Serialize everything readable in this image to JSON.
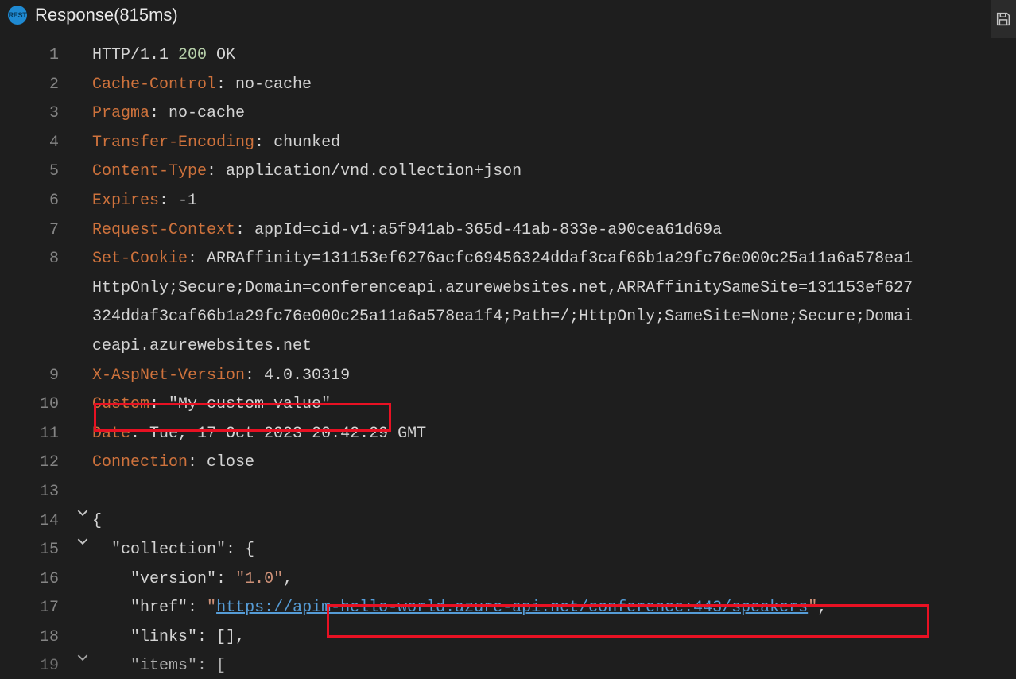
{
  "header": {
    "title": "Response(815ms)"
  },
  "lines": {
    "l1": {
      "proto": "HTTP/1.1 ",
      "code": "200",
      "status": " OK"
    },
    "l2": {
      "name": "Cache-Control",
      "sep": ": ",
      "val": "no-cache"
    },
    "l3": {
      "name": "Pragma",
      "sep": ": ",
      "val": "no-cache"
    },
    "l4": {
      "name": "Transfer-Encoding",
      "sep": ": ",
      "val": "chunked"
    },
    "l5": {
      "name": "Content-Type",
      "sep": ": ",
      "val": "application/vnd.collection+json"
    },
    "l6": {
      "name": "Expires",
      "sep": ": ",
      "val": "-1"
    },
    "l7": {
      "name": "Request-Context",
      "sep": ": ",
      "val": "appId=cid-v1:a5f941ab-365d-41ab-833e-a90cea61d69a"
    },
    "l8": {
      "name": "Set-Cookie",
      "sep": ": ",
      "val1": "ARRAffinity=131153ef6276acfc69456324ddaf3caf66b1a29fc76e000c25a11a6a578ea1",
      "val2": "HttpOnly;Secure;Domain=conferenceapi.azurewebsites.net,ARRAffinitySameSite=131153ef627",
      "val3": "324ddaf3caf66b1a29fc76e000c25a11a6a578ea1f4;Path=/;HttpOnly;SameSite=None;Secure;Domai",
      "val4": "ceapi.azurewebsites.net"
    },
    "l9": {
      "name": "X-AspNet-Version",
      "sep": ": ",
      "val": "4.0.30319"
    },
    "l10": {
      "name": "Custom",
      "sep": ": ",
      "val": "\"My custom value\""
    },
    "l11": {
      "name": "Date",
      "sep": ": ",
      "val": "Tue, 17 Oct 2023 20:42:29 GMT"
    },
    "l12": {
      "name": "Connection",
      "sep": ": ",
      "val": "close"
    },
    "l13": {
      "text": ""
    },
    "l14": {
      "text": "{"
    },
    "l15": {
      "indent": "  ",
      "key": "\"collection\"",
      "after": ": {"
    },
    "l16": {
      "indent": "    ",
      "key": "\"version\"",
      "sep": ": ",
      "val": "\"1.0\"",
      "after": ","
    },
    "l17": {
      "indent": "    ",
      "key": "\"href\"",
      "sep": ": ",
      "q1": "\"",
      "url": "https://apim-hello-world.azure-api.net/conference:443/speakers",
      "q2": "\"",
      "after": ","
    },
    "l18": {
      "indent": "    ",
      "key": "\"links\"",
      "after": ": [],"
    },
    "l19": {
      "indent": "    ",
      "key": "\"items\"",
      "after": ": ["
    }
  },
  "gutter": {
    "n1": "1",
    "n2": "2",
    "n3": "3",
    "n4": "4",
    "n5": "5",
    "n6": "6",
    "n7": "7",
    "n8": "8",
    "n9": "9",
    "n10": "10",
    "n11": "11",
    "n12": "12",
    "n13": "13",
    "n14": "14",
    "n15": "15",
    "n16": "16",
    "n17": "17",
    "n18": "18",
    "n19": "19"
  }
}
